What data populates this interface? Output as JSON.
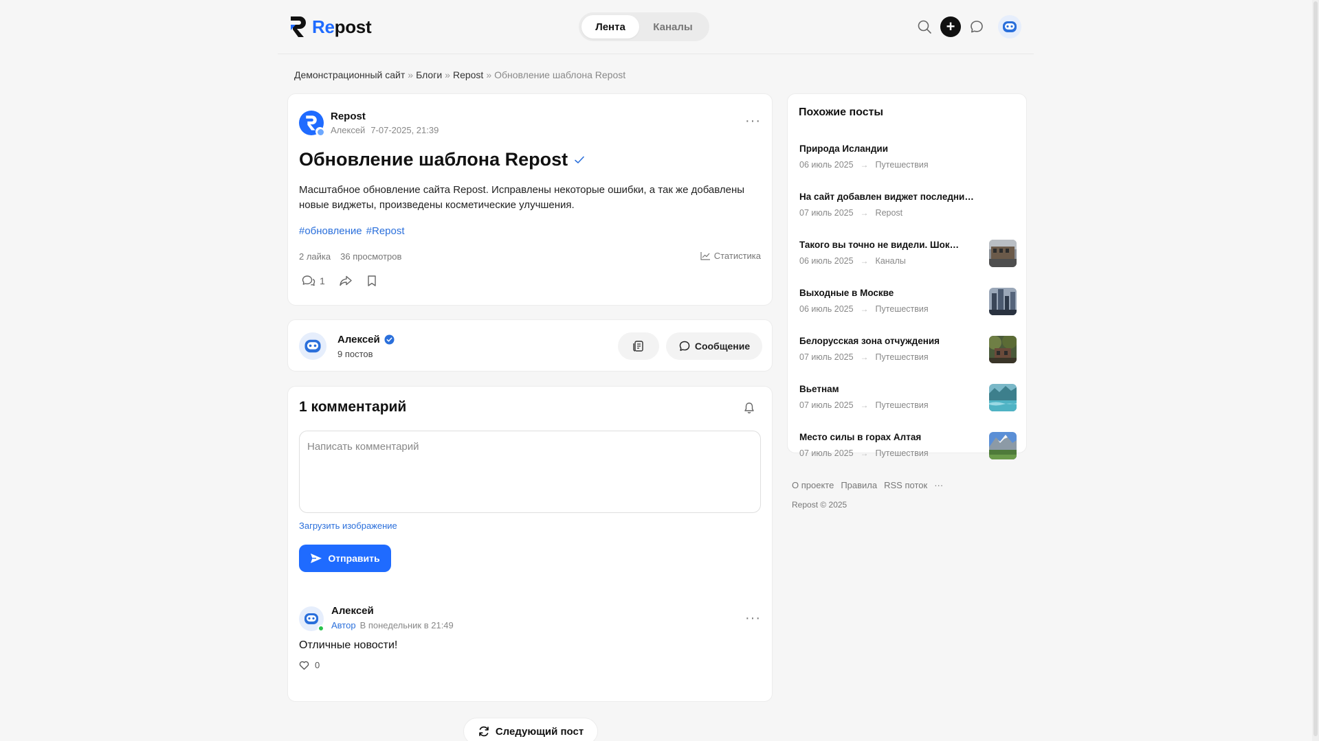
{
  "header": {
    "logo_text_accent": "Re",
    "logo_text_rest": "post",
    "tabs": [
      {
        "label": "Лента",
        "active": true
      },
      {
        "label": "Каналы",
        "active": false
      }
    ],
    "plus_label": "+"
  },
  "breadcrumb": {
    "items": [
      "Демонстрационный сайт",
      "Блоги",
      "Repost"
    ],
    "separator": "»",
    "current": "Обновление шаблона Repost"
  },
  "post": {
    "channel": "Repost",
    "author": "Алексей",
    "date": "7-07-2025, 21:39",
    "title": "Обновление шаблона Repost",
    "text": "Масштабное обновление сайта Repost. Исправлены некоторые ошибки, а так же добавлены новые виджеты, произведены косметические улучшения.",
    "tags": [
      "#обновление",
      "#Repost"
    ],
    "likes": "2 лайка",
    "views": "36 просмотров",
    "stats_label": "Статистика",
    "comments_count": "1",
    "menu": "···"
  },
  "author_card": {
    "name": "Алексей",
    "posts": "9 постов",
    "message_label": "Сообщение"
  },
  "comments": {
    "title": "1 комментарий",
    "placeholder": "Написать комментарий",
    "upload_label": "Загрузить изображение",
    "send_label": "Отправить",
    "items": [
      {
        "author": "Алексей",
        "role": "Автор",
        "time": "В понедельник в 21:49",
        "text": "Отличные новости!",
        "likes": "0"
      }
    ],
    "menu": "···"
  },
  "next_post_label": "Следующий пост",
  "sidebar": {
    "title": "Похожие посты",
    "arrow": "→",
    "items": [
      {
        "title": "Природа Исландии",
        "date": "06 июль 2025",
        "category": "Путешествия",
        "thumb": null
      },
      {
        "title": "На сайт добавлен виджет последних…",
        "date": "07 июль 2025",
        "category": "Repost",
        "thumb": null
      },
      {
        "title": "Такого вы точно не видели. Шок…",
        "date": "06 июль 2025",
        "category": "Каналы",
        "thumb": "street"
      },
      {
        "title": "Выходные в Москве",
        "date": "06 июль 2025",
        "category": "Путешествия",
        "thumb": "city"
      },
      {
        "title": "Белорусская зона отчуждения",
        "date": "07 июль 2025",
        "category": "Путешествия",
        "thumb": "forest"
      },
      {
        "title": "Вьетнам",
        "date": "07 июль 2025",
        "category": "Путешествия",
        "thumb": "water"
      },
      {
        "title": "Место силы в горах Алтая",
        "date": "07 июль 2025",
        "category": "Путешествия",
        "thumb": "mountains"
      }
    ]
  },
  "footer": {
    "links": [
      "О проекте",
      "Правила",
      "RSS поток"
    ],
    "more": "···",
    "copyright": "Repost © 2025"
  },
  "colors": {
    "accent": "#1f6bff",
    "link": "#2a6fdb",
    "background": "#f6f6f6"
  }
}
